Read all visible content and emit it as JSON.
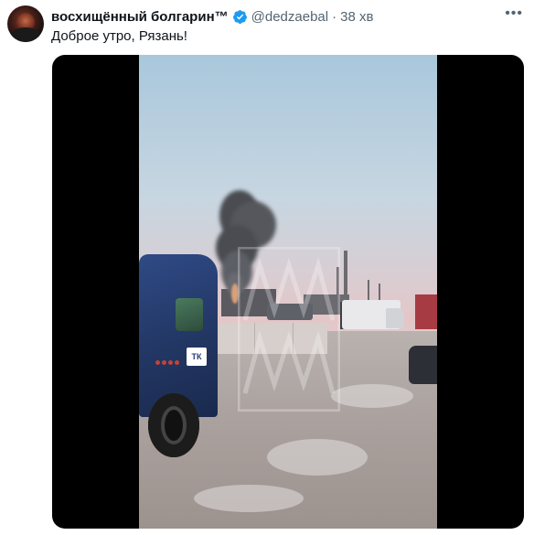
{
  "tweet": {
    "author": {
      "display_name": "восхищённый болгарин™",
      "handle": "@dedzaebal",
      "verified": true,
      "avatar_icon": "avatar-image"
    },
    "separator": "·",
    "timestamp": "38 хв",
    "more_icon": "more-horizontal-icon",
    "more_label": "•••",
    "text": "Доброе утро, Рязань!",
    "media": {
      "type": "video",
      "logo_text": "ТК"
    },
    "colors": {
      "text": "#0f1419",
      "secondary": "#536471",
      "verified_badge": "#1d9bf0"
    }
  }
}
